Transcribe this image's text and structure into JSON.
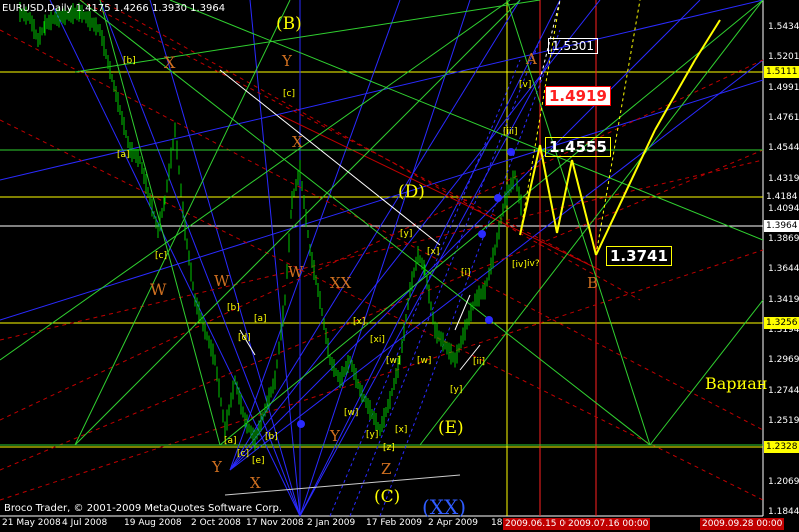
{
  "header": {
    "symbol_info": "EURUSD,Daily  1.4175  1.4266  1.3930  1.3964"
  },
  "footer": {
    "copyright": "Broco Trader, © 2001-2009 MetaQuotes Software Corp."
  },
  "price_axis": {
    "ticks": [
      "1.5434",
      "1.5201",
      "1.4991",
      "1.4761",
      "1.4544",
      "1.4319",
      "1.4094",
      "1.3869",
      "1.3644",
      "1.3419",
      "1.3194",
      "1.2969",
      "1.2744",
      "1.2519",
      "1.2294",
      "1.2069",
      "1.1844"
    ],
    "tags": [
      {
        "value": "1.5111",
        "bg": "#ffff00",
        "fg": "#000000"
      },
      {
        "value": "1.4184",
        "bg": "#000000",
        "fg": "#ffffff"
      },
      {
        "value": "1.3964",
        "bg": "#ffffff",
        "fg": "#000000"
      },
      {
        "value": "1.3256",
        "bg": "#ffff00",
        "fg": "#000000"
      },
      {
        "value": "1.2328",
        "bg": "#ffff00",
        "fg": "#000000"
      }
    ]
  },
  "date_axis": {
    "ticks": [
      "21 May 2008",
      "4 Jul 2008",
      "19 Aug 2008",
      "2 Oct 2008",
      "17 Nov 2008",
      "2 Jan 2009",
      "17 Feb 2009",
      "2 Apr 2009",
      "18"
    ],
    "tags": [
      "2009.06.15 00:00",
      "2009.07.16 00:00",
      "2009.09.28 00:00"
    ]
  },
  "labels": {
    "big": {
      "B": "(B)",
      "D": "(D)",
      "E": "(E)",
      "C": "(C)",
      "XX": "(XX)"
    },
    "orange": {
      "X1": "X",
      "Y1": "Y",
      "W1": "W",
      "W2": "W",
      "X2": "X",
      "XX": "XX",
      "Y2": "Y",
      "Z": "Z",
      "X3": "X",
      "A": "A",
      "B": "B",
      "Y3": "Y"
    },
    "small": [
      "[b]",
      "[c]",
      "[a]",
      "[c]",
      "[b]",
      "[a]",
      "[d]",
      "[c]",
      "[e]",
      "[b]",
      "[a]",
      "[x]",
      "[xi]",
      "[w]",
      "[w]",
      "[w]",
      "[y]",
      "[x]",
      "[x]",
      "[y]",
      "[z]",
      "[y]",
      "[i]",
      "[ii]",
      "[iii]",
      "[v]",
      "iv?",
      "[iv]"
    ],
    "alt": "Вариан"
  },
  "forecast_boxes": [
    {
      "value": "1.5301",
      "color": "#ffffff"
    },
    {
      "value": "1.4919",
      "color": "#ff0000"
    },
    {
      "value": "1.4555",
      "color": "#ffff00"
    },
    {
      "value": "1.3741",
      "color": "#ffff00"
    }
  ],
  "colors": {
    "background": "#000000",
    "candles": "#00c800",
    "wave_lines": "#ffff00",
    "fan_lines": "#2a2aff",
    "channel_green": "#30d030",
    "trend_red": "#c00000",
    "label_orange": "#d07020"
  }
}
